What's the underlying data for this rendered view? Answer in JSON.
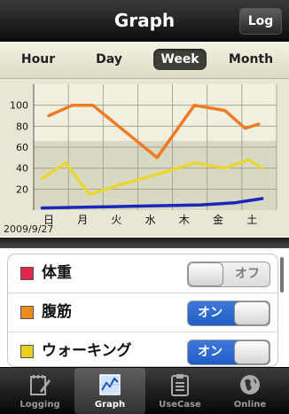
{
  "header": {
    "title": "Graph",
    "log_button": "Log"
  },
  "range_tabs": [
    {
      "label": "Hour",
      "selected": false
    },
    {
      "label": "Day",
      "selected": false
    },
    {
      "label": "Week",
      "selected": true
    },
    {
      "label": "Month",
      "selected": false
    }
  ],
  "graph": {
    "date": "2009/9/27"
  },
  "chart_data": {
    "type": "line",
    "categories": [
      "日",
      "月",
      "火",
      "水",
      "木",
      "金",
      "土"
    ],
    "yticks": [
      20,
      40,
      60,
      80,
      100
    ],
    "ylim": [
      0,
      120
    ],
    "grid": true,
    "series": [
      {
        "color": "#f07b22",
        "values": [
          {
            "x": 0,
            "y": 90
          },
          {
            "x": 0.7,
            "y": 100
          },
          {
            "x": 1.3,
            "y": 100
          },
          {
            "x": 3.2,
            "y": 50
          },
          {
            "x": 4.3,
            "y": 100
          },
          {
            "x": 5.2,
            "y": 95
          },
          {
            "x": 5.8,
            "y": 78
          },
          {
            "x": 6.2,
            "y": 82
          }
        ]
      },
      {
        "color": "#e8d636",
        "values": [
          {
            "x": -0.2,
            "y": 30
          },
          {
            "x": 0.5,
            "y": 45
          },
          {
            "x": 1.2,
            "y": 15
          },
          {
            "x": 2.2,
            "y": 25
          },
          {
            "x": 3.3,
            "y": 35
          },
          {
            "x": 4.3,
            "y": 45
          },
          {
            "x": 5.2,
            "y": 40
          },
          {
            "x": 5.9,
            "y": 48
          },
          {
            "x": 6.3,
            "y": 40
          }
        ]
      },
      {
        "color": "#1a26b8",
        "values": [
          {
            "x": -0.2,
            "y": 2
          },
          {
            "x": 1.5,
            "y": 3
          },
          {
            "x": 3.0,
            "y": 4
          },
          {
            "x": 4.5,
            "y": 5
          },
          {
            "x": 5.5,
            "y": 7
          },
          {
            "x": 6.3,
            "y": 11
          }
        ]
      }
    ]
  },
  "list": {
    "items": [
      {
        "label": "体重",
        "color": "#e0294a",
        "toggle": "オフ",
        "on": false
      },
      {
        "label": "腹筋",
        "color": "#ee8a20",
        "toggle": "オン",
        "on": true
      },
      {
        "label": "ウォーキング",
        "color": "#e8d020",
        "toggle": "オン",
        "on": true
      }
    ]
  },
  "tabbar": {
    "items": [
      {
        "label": "Logging",
        "icon": "pencil-notebook-icon",
        "selected": false
      },
      {
        "label": "Graph",
        "icon": "graph-icon",
        "selected": true
      },
      {
        "label": "UseCase",
        "icon": "clipboard-icon",
        "selected": false
      },
      {
        "label": "Online",
        "icon": "globe-icon",
        "selected": false
      }
    ]
  }
}
